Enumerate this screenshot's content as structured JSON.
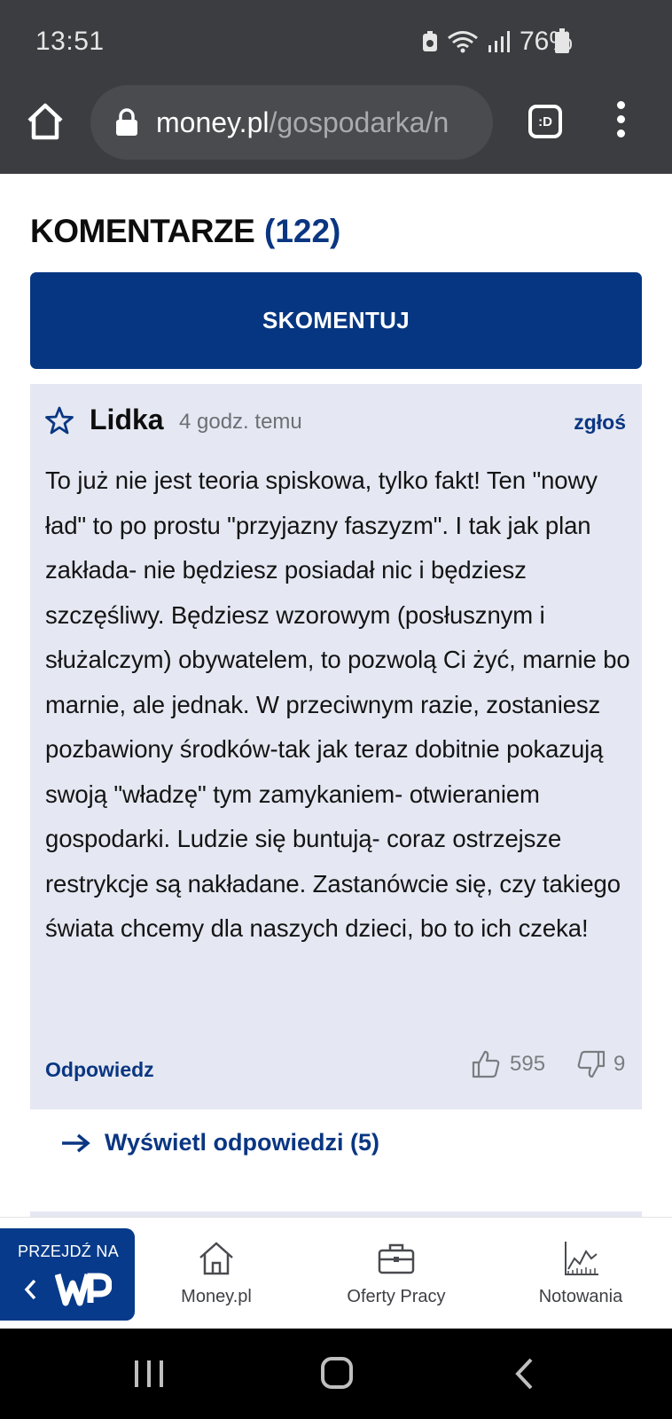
{
  "status_bar": {
    "time": "13:51",
    "battery": "76%",
    "icons": [
      "recycle-icon",
      "wifi-icon",
      "signal-icon",
      "battery-icon"
    ]
  },
  "browser": {
    "url_domain": "money.pl",
    "url_path": "/gospodarka/n",
    "tabs_label": ":D"
  },
  "comments": {
    "title": "KOMENTARZE",
    "count": "(122)",
    "comment_button": "SKOMENTUJ",
    "item": {
      "author": "Lidka",
      "time": "4 godz. temu",
      "report": "zgłoś",
      "text": "To już nie jest teoria spiskowa, tylko fakt! Ten \"nowy ład\" to po prostu \"przyjazny faszyzm\". I tak jak plan zakłada- nie będziesz posiadał nic i będziesz szczęśliwy. Będziesz wzorowym (posłusznym i służalczym) obywatelem, to pozwolą Ci żyć, marnie bo marnie, ale jednak. W przeciwnym razie, zostaniesz pozbawiony środków-tak jak teraz dobitnie pokazują swoją \"władzę\" tym zamykaniem- otwieraniem gospodarki. Ludzie się buntują- coraz ostrzejsze restrykcje są nakładane. Zastanówcie się, czy takiego świata chcemy dla naszych dzieci, bo to ich czeka!",
      "reply": "Odpowiedz",
      "likes": "595",
      "dislikes": "9"
    },
    "show_replies": "Wyświetl odpowiedzi (5)"
  },
  "bottom_nav": {
    "wp_label": "PRZEJDŹ NA",
    "items": [
      {
        "label": "Money.pl",
        "icon": "home-icon"
      },
      {
        "label": "Oferty Pracy",
        "icon": "briefcase-icon"
      },
      {
        "label": "Notowania",
        "icon": "chart-icon"
      }
    ]
  },
  "colors": {
    "brand_blue": "#063682",
    "card_bg": "#e5e8f2",
    "chrome_bg": "#3c3d40"
  }
}
